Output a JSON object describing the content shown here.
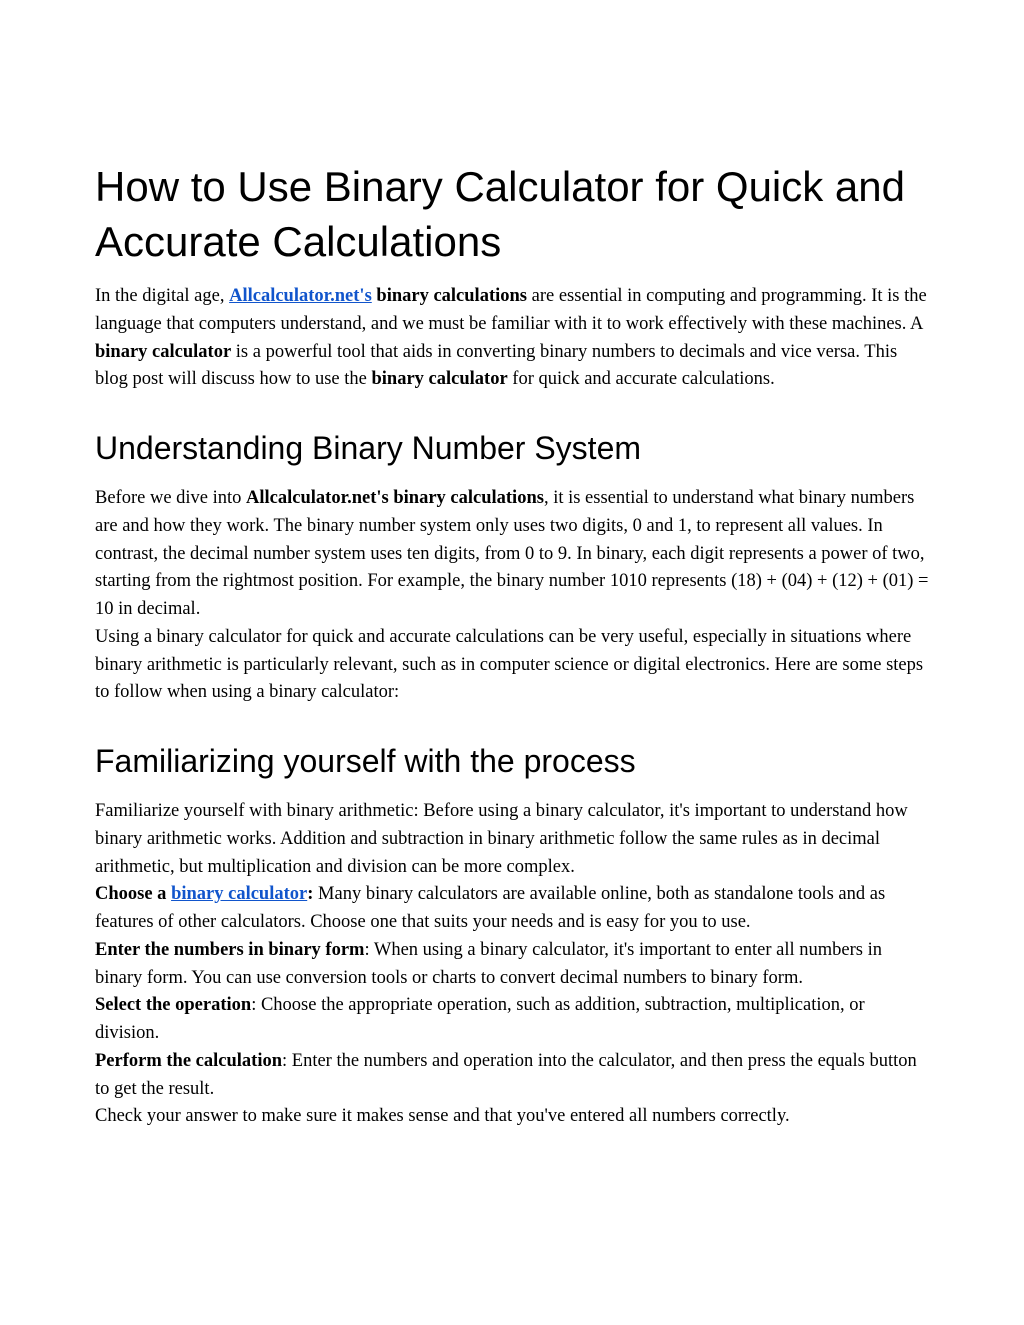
{
  "title": "How to Use Binary Calculator for Quick and Accurate Calculations",
  "intro": {
    "prefix": "In the digital age, ",
    "link1": "Allcalculator.net's",
    "bold1": " binary calculations",
    "text1": " are essential in computing and programming. It is the language that computers understand, and we must be familiar with it to work effectively with these machines. A ",
    "bold2": "binary calculator",
    "text2": " is a powerful tool that aids in converting binary numbers to decimals and vice versa. This blog post will discuss how to use the ",
    "bold3": "binary calculator",
    "text3": " for quick and accurate calculations."
  },
  "section1": {
    "heading": "Understanding Binary Number System",
    "p1_prefix": "Before we dive into ",
    "p1_bold": "Allcalculator.net's binary calculations",
    "p1_text": ", it is essential to understand what binary numbers are and how they work. The binary number system only uses two digits, 0 and 1, to represent all values. In contrast, the decimal number system uses ten digits, from 0 to 9. In binary, each digit represents a power of two, starting from the rightmost position. For example, the binary number 1010 represents (18) + (04) + (12) + (01) = 10 in decimal.",
    "p2": "Using a binary calculator for quick and accurate calculations can be very useful, especially in situations where binary arithmetic is particularly relevant, such as in computer science or digital electronics. Here are some steps to follow when using a binary calculator:"
  },
  "section2": {
    "heading": "Familiarizing yourself with the process",
    "p1": "Familiarize yourself with binary arithmetic: Before using a binary calculator, it's important to understand how binary arithmetic works. Addition and subtraction in binary arithmetic follow the same rules as in decimal arithmetic, but multiplication and division can be more complex.",
    "p2_bold": "Choose a ",
    "p2_link": "binary calculator",
    "p2_bold2": ":",
    "p2_text": " Many binary calculators are available online, both as standalone tools and as features of other calculators. Choose one that suits your needs and is easy for you to use.",
    "p3_bold": "Enter the numbers in binary form",
    "p3_text": ": When using a binary calculator, it's important to enter all numbers in binary form. You can use conversion tools or charts to convert decimal numbers to binary form.",
    "p4_bold": "Select the operation",
    "p4_text": ": Choose the appropriate operation, such as addition, subtraction, multiplication, or division.",
    "p5_bold": "Perform the calculation",
    "p5_text": ": Enter the numbers and operation into the calculator, and then press the equals button to get the result.",
    "p6": "Check your answer to make sure it makes sense and that you've entered all numbers correctly."
  }
}
